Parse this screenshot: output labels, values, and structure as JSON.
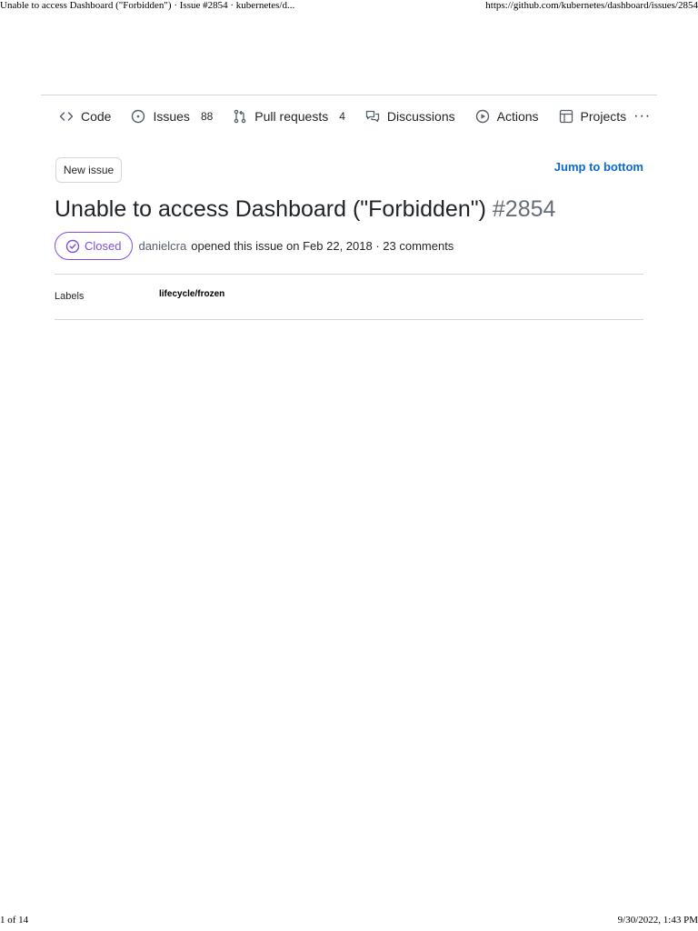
{
  "print": {
    "page_title": "Unable to access Dashboard (\"Forbidden\") · Issue #2854 · kubernetes/d...",
    "url": "https://github.com/kubernetes/dashboard/issues/2854",
    "page_count": "1 of 14",
    "datetime": "9/30/2022, 1:43 PM"
  },
  "nav": {
    "code": "Code",
    "issues": "Issues",
    "issues_count": "88",
    "pulls": "Pull requests",
    "pulls_count": "4",
    "discussions": "Discussions",
    "actions": "Actions",
    "projects": "Projects",
    "more": "···"
  },
  "toolbar": {
    "new_issue": "New issue",
    "jump_to_bottom": "Jump to bottom"
  },
  "issue": {
    "title": "Unable to access Dashboard (\"Forbidden\")",
    "number": "#2854",
    "state": "Closed",
    "author": "danielcra",
    "meta": "opened this issue on Feb 22, 2018 · 23 comments"
  },
  "sidebar": {
    "labels_title": "Labels",
    "labels": [
      "lifecycle/frozen"
    ]
  },
  "colors": {
    "accent_link": "#0969da",
    "closed_purple": "#8250df",
    "border": "#d0d7de"
  }
}
